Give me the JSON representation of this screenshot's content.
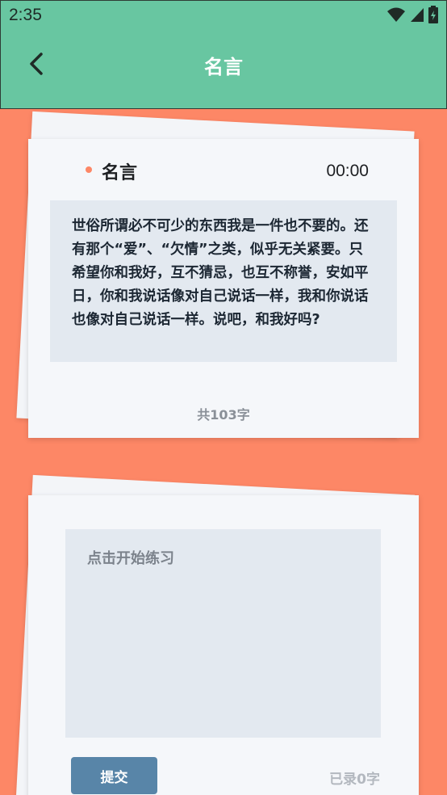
{
  "status_bar": {
    "time": "2:35",
    "icons": [
      "wifi-icon",
      "signal-icon",
      "battery-icon"
    ]
  },
  "app_bar": {
    "back_icon": "chevron-left-icon",
    "title": "名言"
  },
  "quote_card": {
    "title": "名言",
    "timer": "00:00",
    "quote": "世俗所谓必不可少的东西我是一件也不要的。还有那个“爱”、“欠情”之类，似乎无关紧要。只希望你和我好，互不猜忌，也互不称誉，安如平日，你和我说话像对自己说话一样，我和你说话也像对自己说话一样。说吧，和我好吗?",
    "char_count": "共103字"
  },
  "practice_card": {
    "placeholder": "点击开始练习",
    "submit_label": "提交",
    "typed_label": "已录0字"
  },
  "colors": {
    "background": "#fd8766",
    "app_bar": "#68c6a1",
    "accent_dot": "#fd8766",
    "submit": "#5885a8"
  }
}
